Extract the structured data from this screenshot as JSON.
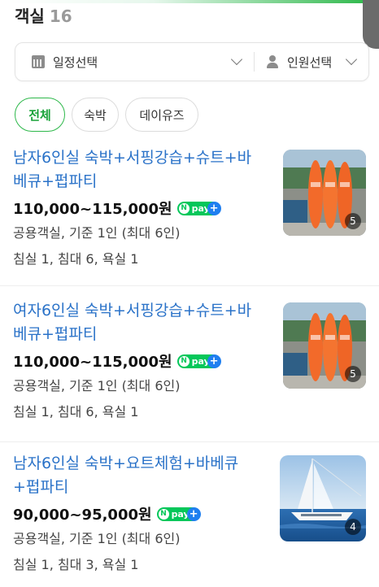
{
  "header": {
    "title": "객실",
    "count": "16"
  },
  "filters": {
    "date_label": "일정선택",
    "people_label": "인원선택"
  },
  "chips": [
    {
      "label": "전체",
      "active": true
    },
    {
      "label": "숙박",
      "active": false
    },
    {
      "label": "데이유즈",
      "active": false
    }
  ],
  "rooms": [
    {
      "name": "남자6인실 숙박+서핑강습+슈트+바베큐+펍파티",
      "price": "110,000~115,000원",
      "npay": "pay",
      "occupancy": "공용객실, 기준 1인 (최대 6인)",
      "facilities": "침실 1, 침대 6, 욕실 1",
      "photo_count": "5",
      "photo": "surfboards"
    },
    {
      "name": "여자6인실 숙박+서핑강습+슈트+바베큐+펍파티",
      "price": "110,000~115,000원",
      "npay": "pay",
      "occupancy": "공용객실, 기준 1인 (최대 6인)",
      "facilities": "침실 1, 침대 6, 욕실 1",
      "photo_count": "5",
      "photo": "surfboards"
    },
    {
      "name": "남자6인실 숙박+요트체험+바베큐+펍파티",
      "price": "90,000~95,000원",
      "npay": "pay",
      "occupancy": "공용객실, 기준 1인 (최대 6인)",
      "facilities": "침실 1, 침대 3, 욕실 1",
      "photo_count": "4",
      "photo": "yacht"
    }
  ],
  "colors": {
    "accent_green": "#2db84a",
    "link_blue": "#2a72c8",
    "npay_green": "#04c75a",
    "npay_blue": "#1f7ff0"
  }
}
